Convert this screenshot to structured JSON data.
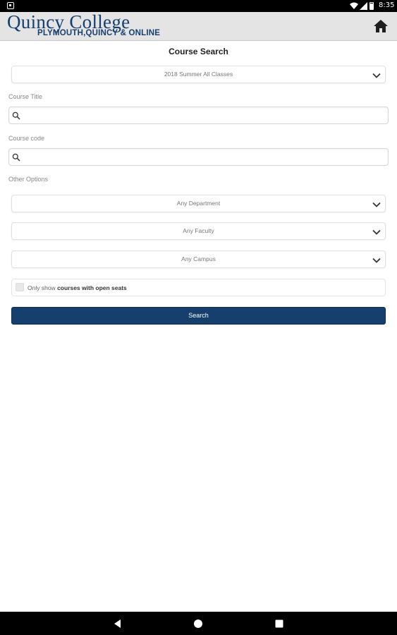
{
  "status_bar": {
    "time": "8:35"
  },
  "header": {
    "logo_main": "Quincy College",
    "logo_sub": "PLYMOUTH,QUINCY & ONLINE"
  },
  "page": {
    "title": "Course Search"
  },
  "term_select": {
    "value": "2018 Summer All Classes"
  },
  "course_title": {
    "label": "Course Title",
    "value": "",
    "placeholder": ""
  },
  "course_code": {
    "label": "Course code",
    "value": "",
    "placeholder": ""
  },
  "other_options": {
    "label": "Other Options"
  },
  "department_select": {
    "value": "Any Department"
  },
  "faculty_select": {
    "value": "Any Faculty"
  },
  "campus_select": {
    "value": "Any Campus"
  },
  "open_seats": {
    "prefix": "Only show",
    "emphasis": "courses with open seats",
    "checked": false
  },
  "search_button": {
    "label": "Search"
  },
  "colors": {
    "brand": "#173f6e",
    "header_bg": "#e4e4e4"
  }
}
